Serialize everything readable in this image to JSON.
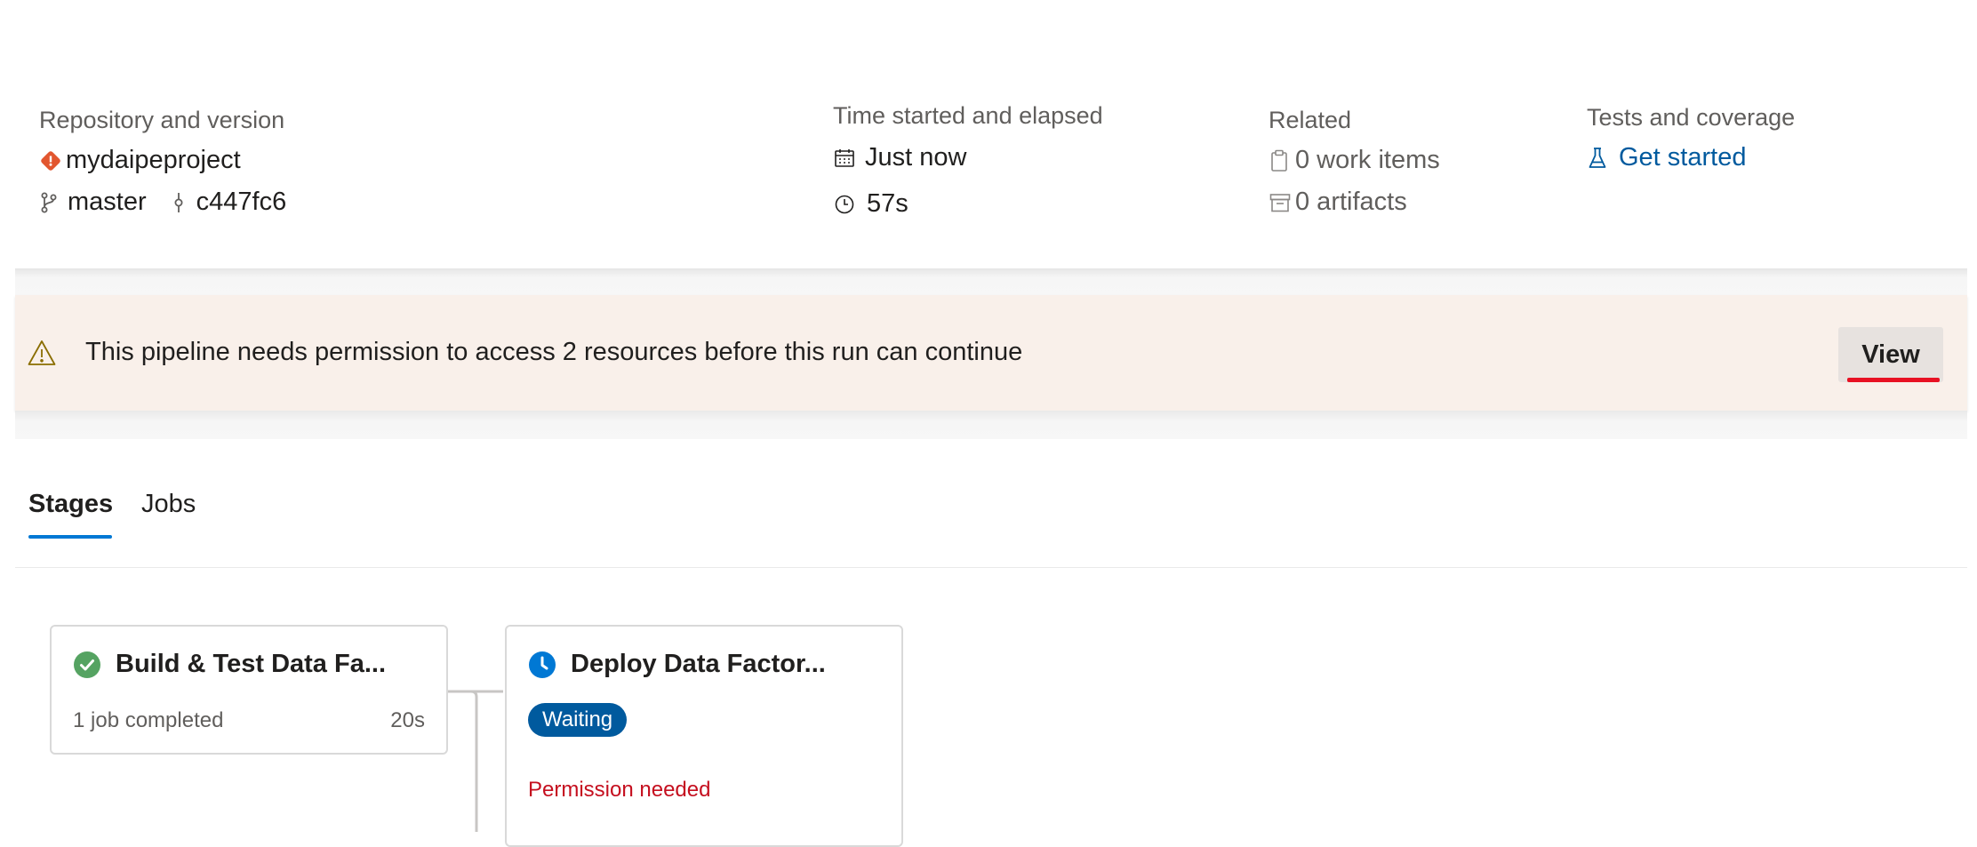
{
  "summary": {
    "repository": {
      "label": "Repository and version",
      "name": "mydaipeproject",
      "branch": "master",
      "commit": "c447fc6"
    },
    "time": {
      "label": "Time started and elapsed",
      "started": "Just now",
      "elapsed": "57s"
    },
    "related": {
      "label": "Related",
      "work_items": "0 work items",
      "artifacts": "0 artifacts"
    },
    "tests": {
      "label": "Tests and coverage",
      "link": "Get started"
    }
  },
  "banner": {
    "message": "This pipeline needs permission to access 2 resources before this run can continue",
    "button": "View"
  },
  "tabs": [
    {
      "label": "Stages",
      "active": true
    },
    {
      "label": "Jobs",
      "active": false
    }
  ],
  "stages": [
    {
      "title": "Build & Test Data Fa...",
      "status": "succeeded",
      "subtitle": "1 job completed",
      "duration": "20s"
    },
    {
      "title": "Deploy Data Factor...",
      "status": "waiting",
      "badge": "Waiting",
      "note": "Permission needed"
    }
  ],
  "colors": {
    "accent": "#0078d4",
    "link": "#005a9e",
    "success": "#107c10",
    "error": "#c50f1f",
    "warning": "#8a6d00",
    "banner_bg": "#f9f0ea"
  },
  "icons": {
    "repo": "git-repo-icon",
    "branch": "branch-icon",
    "commit": "commit-icon",
    "calendar": "calendar-icon",
    "clock": "clock-icon",
    "work_items": "clipboard-icon",
    "artifacts": "artifact-box-icon",
    "tests": "beaker-icon",
    "warning": "warning-icon",
    "success": "check-circle-icon",
    "waiting": "clock-circle-icon"
  }
}
